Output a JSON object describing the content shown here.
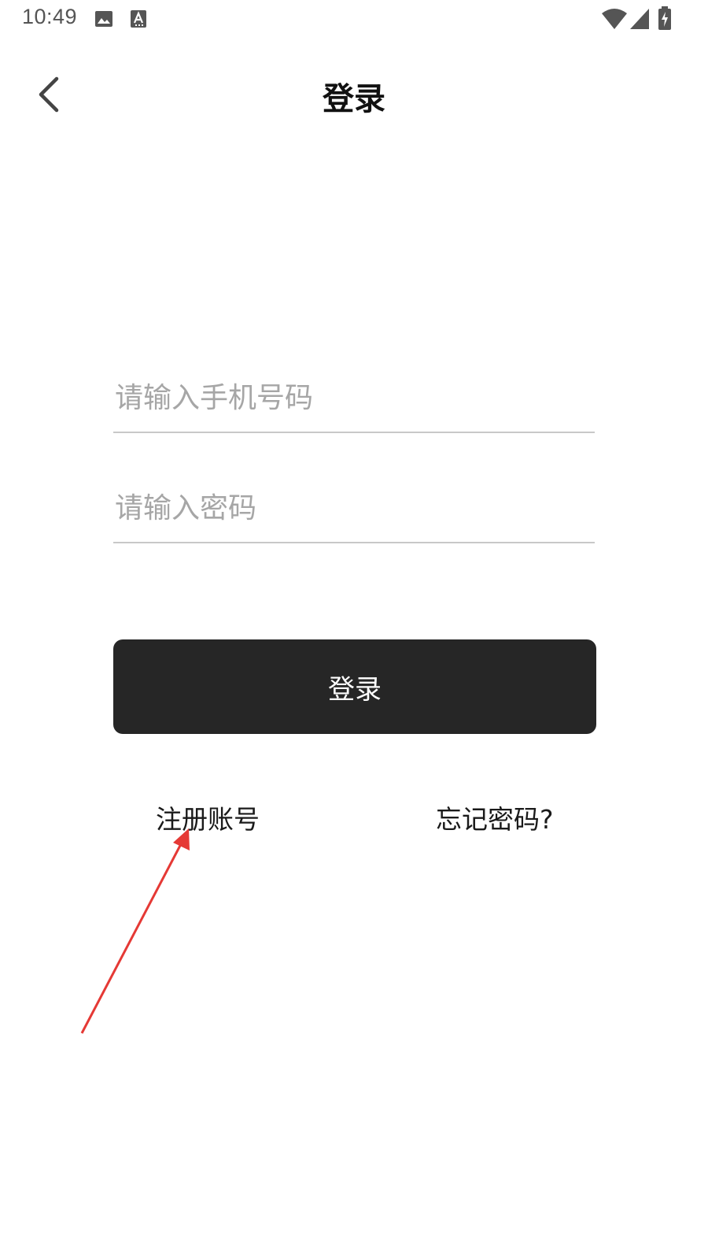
{
  "status_bar": {
    "time": "10:49",
    "left_icons": [
      "image-icon",
      "text-a-icon"
    ],
    "right_icons": [
      "wifi-icon",
      "cell-signal-icon",
      "battery-charging-icon"
    ]
  },
  "app_bar": {
    "back_icon": "chevron-left-icon",
    "title": "登录"
  },
  "form": {
    "phone_placeholder": "请输入手机号码",
    "phone_value": "",
    "password_placeholder": "请输入密码",
    "password_value": "",
    "login_label": "登录"
  },
  "links": {
    "register": "注册账号",
    "forgot_password": "忘记密码?"
  },
  "annotation": {
    "arrow_color": "#e53935"
  },
  "colors": {
    "button_bg": "#262626",
    "placeholder": "#a6a6a6",
    "divider": "#c8c8c8"
  }
}
